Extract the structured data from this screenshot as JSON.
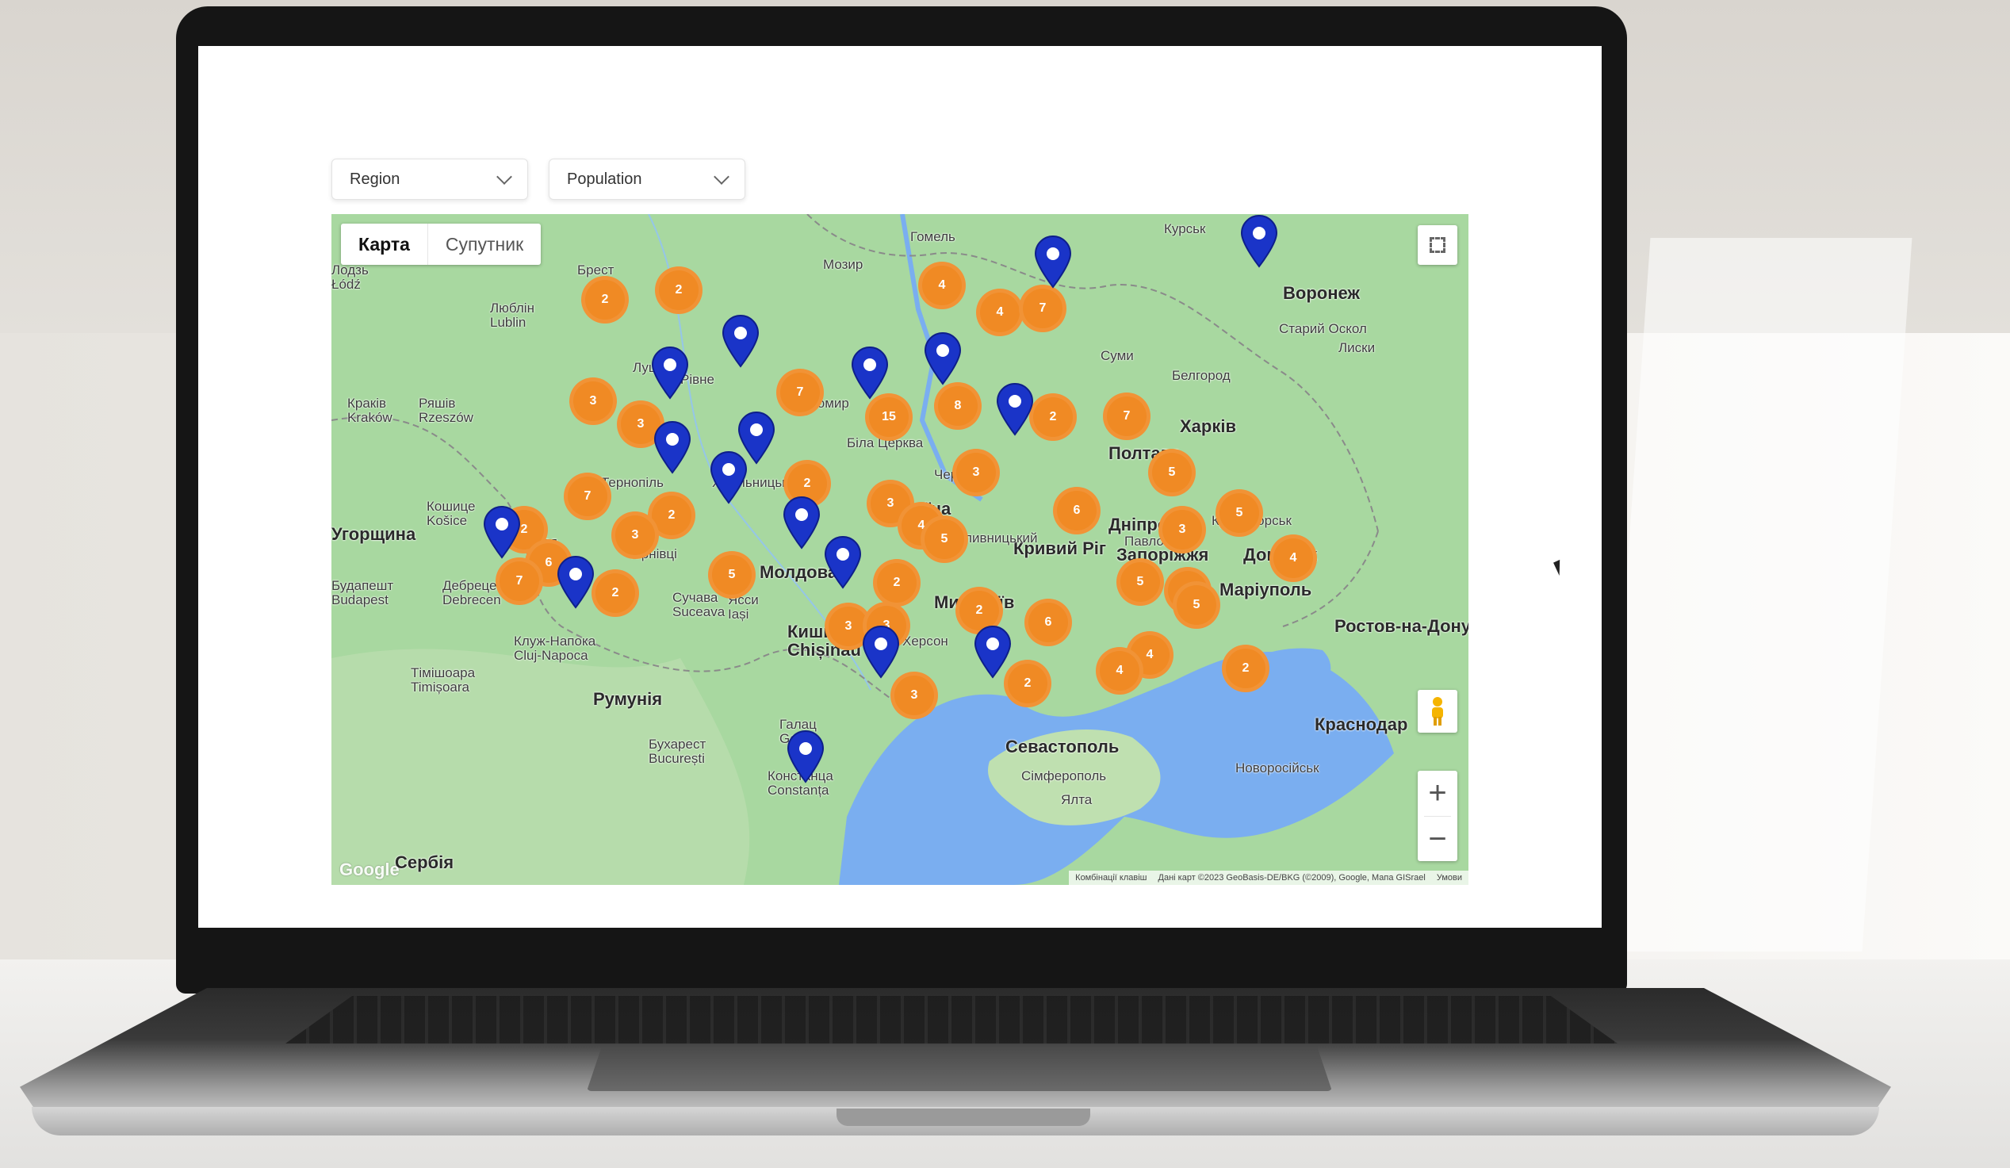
{
  "filters": {
    "region_label": "Region",
    "population_label": "Population"
  },
  "map_controls": {
    "map_type_map": "Карта",
    "map_type_satellite": "Супутник",
    "zoom_in": "+",
    "zoom_out": "−"
  },
  "attribution": {
    "shortcuts": "Комбінації клавіш",
    "map_data": "Дані карт ©2023 GeoBasis-DE/BKG (©2009), Google, Мапа GISrael",
    "terms": "Умови"
  },
  "google_logo": "Google",
  "places": [
    {
      "key": "lodz",
      "label": "Лодзь\nŁódź"
    },
    {
      "key": "lublin",
      "label": "Люблін\nLublin"
    },
    {
      "key": "rzeszow",
      "label": "Ряшів\nRzeszów"
    },
    {
      "key": "krakow",
      "label": "Краків\nKraków"
    },
    {
      "key": "kosice",
      "label": "Кошице\nKošice"
    },
    {
      "key": "ugorshchyna",
      "label": "Угорщина"
    },
    {
      "key": "debrecen",
      "label": "Дебрецен\nDebrecen"
    },
    {
      "key": "budapest",
      "label": "Будапешт\nBudapest"
    },
    {
      "key": "cluj",
      "label": "Клуж-Напока\nCluj-Napoca"
    },
    {
      "key": "moldova",
      "label": "Молдова"
    },
    {
      "key": "iasi",
      "label": "Ясси\nIași"
    },
    {
      "key": "chisinau",
      "label": "Кишинів\nChișinău"
    },
    {
      "key": "romania",
      "label": "Румунія"
    },
    {
      "key": "timisoara",
      "label": "Тімішоара\nTimișoara"
    },
    {
      "key": "bucharest",
      "label": "Бухарест\nBucurești"
    },
    {
      "key": "serbia",
      "label": "Сербія"
    },
    {
      "key": "constanta",
      "label": "Констанца\nConstanța"
    },
    {
      "key": "ukraine",
      "label": "Україна"
    },
    {
      "key": "poltava",
      "label": "Полтава"
    },
    {
      "key": "kryvyi_rih",
      "label": "Кривий Ріг"
    },
    {
      "key": "zaporizhzhia",
      "label": "Запоріжжя"
    },
    {
      "key": "dnipro",
      "label": "Дніпро"
    },
    {
      "key": "donetsk",
      "label": "Донецьк"
    },
    {
      "key": "mykolaiv",
      "label": "Миколаїв"
    },
    {
      "key": "mariupol",
      "label": "Маріуполь"
    },
    {
      "key": "rostov",
      "label": "Ростов-на-Дону"
    },
    {
      "key": "sevastopol",
      "label": "Севастополь"
    },
    {
      "key": "krasnodar",
      "label": "Краснодар"
    },
    {
      "key": "voronezh",
      "label": "Воронеж"
    },
    {
      "key": "kharkiv",
      "label": "Харків"
    },
    {
      "key": "belgorod",
      "label": "Белгород"
    },
    {
      "key": "sumy",
      "label": "Суми"
    },
    {
      "key": "zhytomyr",
      "label": "Житомир"
    },
    {
      "key": "rivne",
      "label": "Рівне"
    },
    {
      "key": "lutsk",
      "label": "Луцьк"
    },
    {
      "key": "ternopil",
      "label": "Тернопіль"
    },
    {
      "key": "khmelnytskyi",
      "label": "Хмельницький"
    },
    {
      "key": "uzhhorod",
      "label": "Ужгород"
    },
    {
      "key": "chernivtsi",
      "label": "Чернівці"
    },
    {
      "key": "bila_tserkva",
      "label": "Біла Церква"
    },
    {
      "key": "cherkasy",
      "label": "Черкаси"
    },
    {
      "key": "kropyvnytskyi",
      "label": "Кропивницький"
    },
    {
      "key": "kramatorsk",
      "label": "Краматорськ"
    },
    {
      "key": "pavlohrad",
      "label": "Павлоград"
    },
    {
      "key": "brest",
      "label": "Брест"
    },
    {
      "key": "gomel",
      "label": "Гомель"
    },
    {
      "key": "kursk",
      "label": "Курськ"
    },
    {
      "key": "mozyr",
      "label": "Мозир"
    },
    {
      "key": "starsy_oskol",
      "label": "Старий Оскол"
    },
    {
      "key": "liski",
      "label": "Лиски"
    },
    {
      "key": "suceava",
      "label": "Сучава\nSuceava"
    },
    {
      "key": "galati",
      "label": "Галац\nGalați"
    },
    {
      "key": "kherson",
      "label": "Херсон"
    },
    {
      "key": "novorossiysk",
      "label": "Новоросійськ"
    },
    {
      "key": "yalta",
      "label": "Ялта"
    },
    {
      "key": "simferopol",
      "label": "Сімферополь"
    }
  ],
  "clusters": [
    "2",
    "2",
    "4",
    "4",
    "7",
    "3",
    "3",
    "7",
    "15",
    "8",
    "2",
    "7",
    "3",
    "5",
    "6",
    "2",
    "7",
    "2",
    "3",
    "2",
    "3",
    "4",
    "5",
    "5",
    "2",
    "6",
    "7",
    "2",
    "5",
    "3",
    "5",
    "4",
    "4",
    "5",
    "6",
    "4",
    "4",
    "2",
    "3",
    "3",
    "3",
    "2",
    "2"
  ],
  "pins_count": 17,
  "colors": {
    "cluster": "#f08a24",
    "pin": "#1a34c8",
    "land": "#a6d6a0",
    "water": "#7aaef0"
  }
}
